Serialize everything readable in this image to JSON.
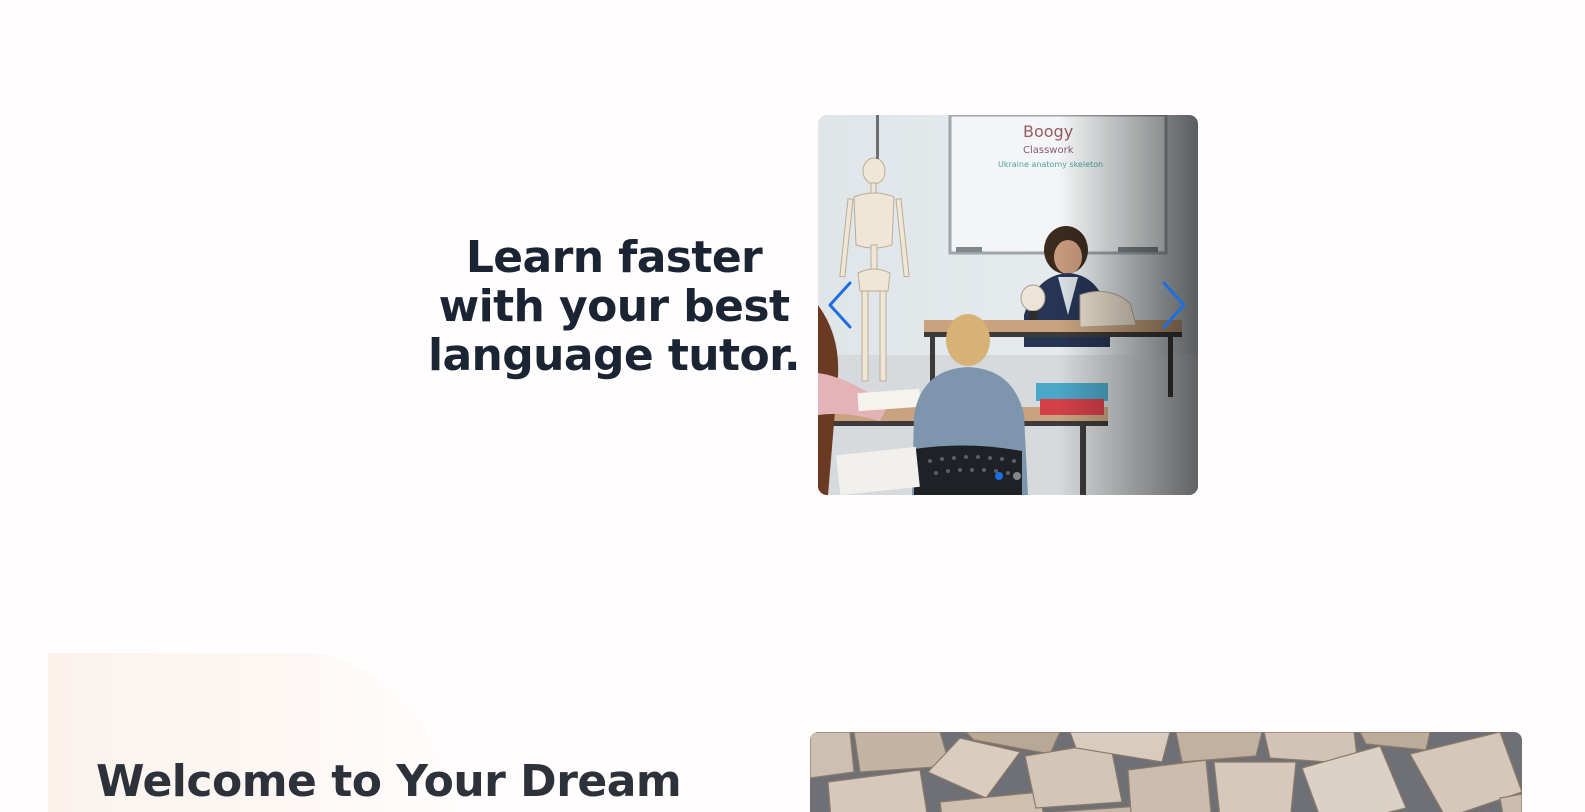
{
  "hero": {
    "title": "Learn faster with your best language tutor."
  },
  "carousel": {
    "image_icon": "classroom-photo",
    "prev_icon": "chevron-left-icon",
    "next_icon": "chevron-right-icon",
    "slide_count": 2,
    "active_index": 0,
    "accent_color": "#1d6fe0"
  },
  "welcome": {
    "title": "Welcome to Your Dream",
    "image_icon": "wooden-blocks-photo"
  }
}
